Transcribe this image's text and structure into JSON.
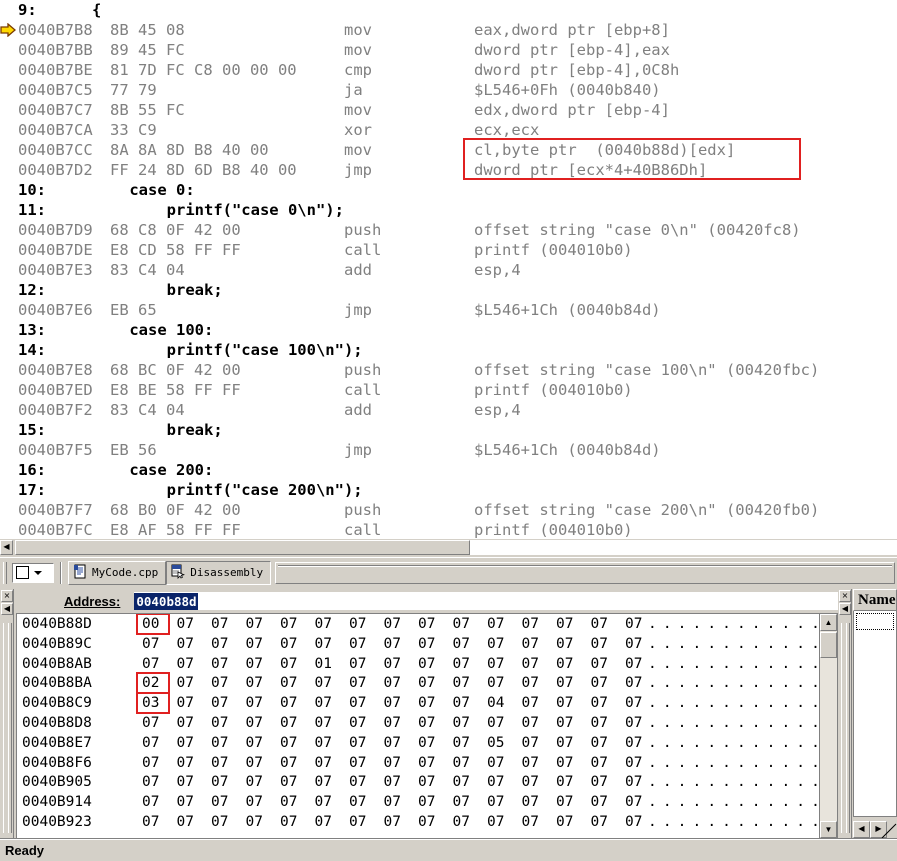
{
  "window": {
    "status_text": "Ready"
  },
  "disassembly": {
    "current_ip_marker": "yellow-arrow",
    "lines": [
      {
        "type": "source",
        "num": "9:",
        "text": "{"
      },
      {
        "type": "asm",
        "ip": true,
        "addr": "0040B7B8",
        "bytes": "8B 45 08",
        "mnem": "mov",
        "ops": "eax,dword ptr [ebp+8]"
      },
      {
        "type": "asm",
        "addr": "0040B7BB",
        "bytes": "89 45 FC",
        "mnem": "mov",
        "ops": "dword ptr [ebp-4],eax"
      },
      {
        "type": "asm",
        "addr": "0040B7BE",
        "bytes": "81 7D FC C8 00 00 00",
        "mnem": "cmp",
        "ops": "dword ptr [ebp-4],0C8h"
      },
      {
        "type": "asm",
        "addr": "0040B7C5",
        "bytes": "77 79",
        "mnem": "ja",
        "ops": "$L546+0Fh (0040b840)"
      },
      {
        "type": "asm",
        "addr": "0040B7C7",
        "bytes": "8B 55 FC",
        "mnem": "mov",
        "ops": "edx,dword ptr [ebp-4]"
      },
      {
        "type": "asm",
        "addr": "0040B7CA",
        "bytes": "33 C9",
        "mnem": "xor",
        "ops": "ecx,ecx"
      },
      {
        "type": "asm",
        "addr": "0040B7CC",
        "bytes": "8A 8A 8D B8 40 00",
        "mnem": "mov",
        "ops": "cl,byte ptr  (0040b88d)[edx]"
      },
      {
        "type": "asm",
        "addr": "0040B7D2",
        "bytes": "FF 24 8D 6D B8 40 00",
        "mnem": "jmp",
        "ops": "dword ptr [ecx*4+40B86Dh]"
      },
      {
        "type": "source",
        "num": "10:",
        "text": "    case 0:"
      },
      {
        "type": "source",
        "num": "11:",
        "text": "        printf(\"case 0\\n\");"
      },
      {
        "type": "asm",
        "addr": "0040B7D9",
        "bytes": "68 C8 0F 42 00",
        "mnem": "push",
        "ops": "offset string \"case 0\\n\" (00420fc8)"
      },
      {
        "type": "asm",
        "addr": "0040B7DE",
        "bytes": "E8 CD 58 FF FF",
        "mnem": "call",
        "ops": "printf (004010b0)"
      },
      {
        "type": "asm",
        "addr": "0040B7E3",
        "bytes": "83 C4 04",
        "mnem": "add",
        "ops": "esp,4"
      },
      {
        "type": "source",
        "num": "12:",
        "text": "        break;"
      },
      {
        "type": "asm",
        "addr": "0040B7E6",
        "bytes": "EB 65",
        "mnem": "jmp",
        "ops": "$L546+1Ch (0040b84d)"
      },
      {
        "type": "source",
        "num": "13:",
        "text": "    case 100:"
      },
      {
        "type": "source",
        "num": "14:",
        "text": "        printf(\"case 100\\n\");"
      },
      {
        "type": "asm",
        "addr": "0040B7E8",
        "bytes": "68 BC 0F 42 00",
        "mnem": "push",
        "ops": "offset string \"case 100\\n\" (00420fbc)"
      },
      {
        "type": "asm",
        "addr": "0040B7ED",
        "bytes": "E8 BE 58 FF FF",
        "mnem": "call",
        "ops": "printf (004010b0)"
      },
      {
        "type": "asm",
        "addr": "0040B7F2",
        "bytes": "83 C4 04",
        "mnem": "add",
        "ops": "esp,4"
      },
      {
        "type": "source",
        "num": "15:",
        "text": "        break;"
      },
      {
        "type": "asm",
        "addr": "0040B7F5",
        "bytes": "EB 56",
        "mnem": "jmp",
        "ops": "$L546+1Ch (0040b84d)"
      },
      {
        "type": "source",
        "num": "16:",
        "text": "    case 200:"
      },
      {
        "type": "source",
        "num": "17:",
        "text": "        printf(\"case 200\\n\");"
      },
      {
        "type": "asm",
        "addr": "0040B7F7",
        "bytes": "68 B0 0F 42 00",
        "mnem": "push",
        "ops": "offset string \"case 200\\n\" (00420fb0)"
      },
      {
        "type": "asm",
        "addr": "0040B7FC",
        "bytes": "E8 AF 58 FF FF",
        "mnem": "call",
        "ops": "printf (004010b0)"
      }
    ],
    "highlight_color": "#e02020"
  },
  "tabstrip": {
    "tabs": [
      {
        "label": "MyCode.cpp",
        "icon": "source-file-icon",
        "active": false
      },
      {
        "label": "Disassembly",
        "icon": "disassembly-icon",
        "active": true
      }
    ]
  },
  "memory": {
    "address_label": "Address:",
    "address_value": "0040b88d",
    "rows": [
      {
        "addr": "0040B88D",
        "bytes": [
          "00",
          "07",
          "07",
          "07",
          "07",
          "07",
          "07",
          "07",
          "07",
          "07",
          "07",
          "07",
          "07",
          "07",
          "07"
        ],
        "ascii": "...............",
        "boxed": [
          0
        ]
      },
      {
        "addr": "0040B89C",
        "bytes": [
          "07",
          "07",
          "07",
          "07",
          "07",
          "07",
          "07",
          "07",
          "07",
          "07",
          "07",
          "07",
          "07",
          "07",
          "07"
        ],
        "ascii": "...............",
        "boxed": []
      },
      {
        "addr": "0040B8AB",
        "bytes": [
          "07",
          "07",
          "07",
          "07",
          "07",
          "01",
          "07",
          "07",
          "07",
          "07",
          "07",
          "07",
          "07",
          "07",
          "07"
        ],
        "ascii": "...............",
        "boxed": []
      },
      {
        "addr": "0040B8BA",
        "bytes": [
          "02",
          "07",
          "07",
          "07",
          "07",
          "07",
          "07",
          "07",
          "07",
          "07",
          "07",
          "07",
          "07",
          "07",
          "07"
        ],
        "ascii": "...............",
        "boxed": [
          0
        ]
      },
      {
        "addr": "0040B8C9",
        "bytes": [
          "03",
          "07",
          "07",
          "07",
          "07",
          "07",
          "07",
          "07",
          "07",
          "07",
          "04",
          "07",
          "07",
          "07",
          "07"
        ],
        "ascii": "...............",
        "boxed": [
          0
        ]
      },
      {
        "addr": "0040B8D8",
        "bytes": [
          "07",
          "07",
          "07",
          "07",
          "07",
          "07",
          "07",
          "07",
          "07",
          "07",
          "07",
          "07",
          "07",
          "07",
          "07"
        ],
        "ascii": "...............",
        "boxed": []
      },
      {
        "addr": "0040B8E7",
        "bytes": [
          "07",
          "07",
          "07",
          "07",
          "07",
          "07",
          "07",
          "07",
          "07",
          "07",
          "05",
          "07",
          "07",
          "07",
          "07"
        ],
        "ascii": "...............",
        "boxed": []
      },
      {
        "addr": "0040B8F6",
        "bytes": [
          "07",
          "07",
          "07",
          "07",
          "07",
          "07",
          "07",
          "07",
          "07",
          "07",
          "07",
          "07",
          "07",
          "07",
          "07"
        ],
        "ascii": "...............",
        "boxed": []
      },
      {
        "addr": "0040B905",
        "bytes": [
          "07",
          "07",
          "07",
          "07",
          "07",
          "07",
          "07",
          "07",
          "07",
          "07",
          "07",
          "07",
          "07",
          "07",
          "07"
        ],
        "ascii": "...............",
        "boxed": []
      },
      {
        "addr": "0040B914",
        "bytes": [
          "07",
          "07",
          "07",
          "07",
          "07",
          "07",
          "07",
          "07",
          "07",
          "07",
          "07",
          "07",
          "07",
          "07",
          "07"
        ],
        "ascii": "...............",
        "boxed": []
      },
      {
        "addr": "0040B923",
        "bytes": [
          "07",
          "07",
          "07",
          "07",
          "07",
          "07",
          "07",
          "07",
          "07",
          "07",
          "07",
          "07",
          "07",
          "07",
          "07"
        ],
        "ascii": "...............",
        "boxed": []
      }
    ]
  },
  "watch": {
    "column_header": "Name"
  },
  "icons": {
    "close": "×",
    "left_arrow": "◄",
    "right_arrow": "►",
    "up_arrow": "▲",
    "down_arrow": "▼"
  }
}
